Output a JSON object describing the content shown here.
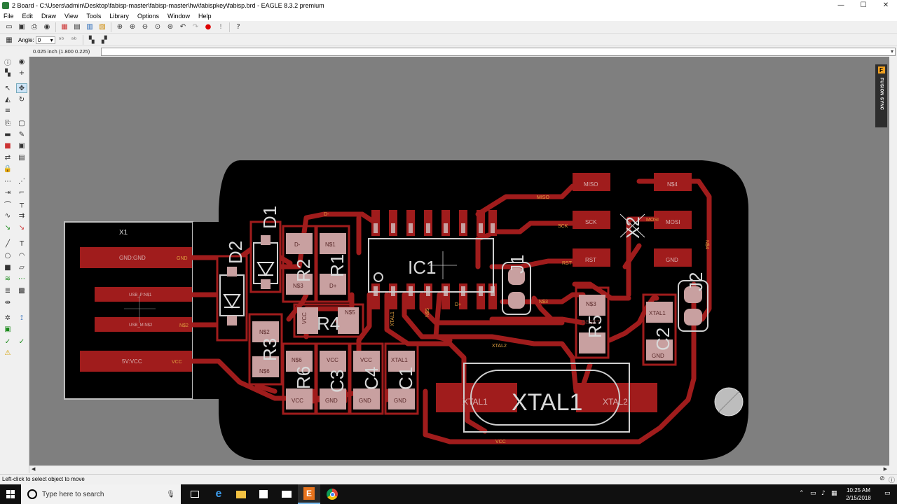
{
  "window": {
    "title": "2 Board - C:\\Users\\admin\\Desktop\\fabisp-master\\fabisp-master\\hw\\fabispkey\\fabisp.brd - EAGLE 8.3.2 premium",
    "controls": {
      "minimize": "—",
      "maximize": "☐",
      "close": "✕"
    }
  },
  "menu": [
    "File",
    "Edit",
    "Draw",
    "View",
    "Tools",
    "Library",
    "Options",
    "Window",
    "Help"
  ],
  "toolbar_icons": [
    "open-icon",
    "save-icon",
    "print-icon",
    "cam-icon",
    "board-icon",
    "schematic-icon",
    "script-icon",
    "run-icon",
    "zoom-fit-icon",
    "zoom-in-icon",
    "zoom-out-icon",
    "zoom-select-icon",
    "redraw-icon",
    "undo-icon",
    "redo-icon",
    "stop-icon",
    "go-icon",
    "help-icon"
  ],
  "params": {
    "angle_label": "Angle:",
    "angle_value": "0"
  },
  "coordinates": "0.025 inch (1.800 0.225)",
  "left_tools": [
    "info-icon",
    "show-icon",
    "display-icon",
    "mark-icon",
    "move-icon",
    "rotate-icon",
    "mirror-icon",
    "copy-icon",
    "paste-icon",
    "delete-icon",
    "add-icon",
    "value-icon",
    "lock-icon",
    "smash-icon",
    "split-icon",
    "route-icon",
    "wire-icon",
    "text-icon",
    "circle-icon",
    "arc-icon",
    "rect-icon",
    "polygon-icon",
    "via-icon",
    "hole-icon",
    "drc-icon",
    "erc-icon",
    "errors-icon"
  ],
  "board": {
    "connector_label": "X1",
    "usb_pads": [
      "GND:GND",
      "USB_P:N$1",
      "USB_M:N$2",
      "5V:VCC"
    ],
    "usb_net_labels": [
      "GND",
      "N$1",
      "N$2",
      "VCC"
    ],
    "part_names": [
      "D1",
      "D2",
      "R2",
      "R1",
      "R3",
      "R4",
      "R6",
      "C3",
      "C4",
      "C1",
      "C2",
      "R5",
      "IC1",
      "J1",
      "J2",
      "X2",
      "XTAL1"
    ],
    "isp_pads": [
      "MISO",
      "SCK",
      "RST",
      "N$4",
      "MOSI",
      "GND"
    ],
    "pin_labels": {
      "r2": [
        "D-",
        "N$3"
      ],
      "r1": [
        "N$1",
        "D+"
      ],
      "r3": [
        "N$2",
        "N$6"
      ],
      "r4": [
        "VCC",
        "N$5"
      ],
      "r6": [
        "N$6",
        "VCC"
      ],
      "c3": [
        "VCC",
        "GND"
      ],
      "c4": [
        "VCC",
        "GND"
      ],
      "c1": [
        "XTAL1",
        "GND"
      ],
      "c2": [
        "XTAL1",
        "GND"
      ],
      "r5": [
        "N$3",
        "RESET"
      ],
      "xtal": [
        "XTAL1",
        "XTAL2"
      ]
    },
    "trace_labels": [
      "MISO",
      "SCK",
      "RST",
      "N$4",
      "MOSI",
      "VCC",
      "XTAL2",
      "XTAL1",
      "N$3",
      "N$5",
      "D+",
      "D-"
    ]
  },
  "fusion_sync": {
    "badge": "F",
    "label": "FUSION SYNC"
  },
  "status": {
    "message": "Left-click to select object to move"
  },
  "taskbar": {
    "search_placeholder": "Type here to search",
    "apps": [
      "task-view-icon",
      "edge-icon",
      "file-explorer-icon",
      "store-icon",
      "mail-icon",
      "eagle-icon",
      "chrome-icon"
    ],
    "time": "10:25 AM",
    "date": "2/15/2018"
  }
}
